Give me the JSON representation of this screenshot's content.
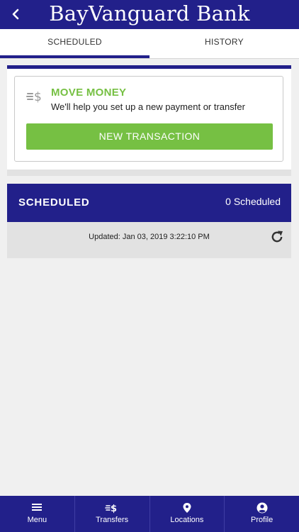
{
  "header": {
    "title": "BayVanguard Bank",
    "back_icon": "chevron-left-icon"
  },
  "tabs": [
    {
      "label": "SCHEDULED",
      "active": true
    },
    {
      "label": "HISTORY",
      "active": false
    }
  ],
  "move_money": {
    "icon": "transfer-dollar-icon",
    "title": "MOVE MONEY",
    "subtitle": "We'll help you set up a new payment or transfer",
    "button_label": "NEW TRANSACTION"
  },
  "scheduled": {
    "title": "SCHEDULED",
    "count_label": "0 Scheduled",
    "updated_prefix": "Updated: ",
    "updated_value": "Jan 03, 2019 3:22:10 PM",
    "refresh_icon": "refresh-icon"
  },
  "bottom_nav": [
    {
      "label": "Menu",
      "icon": "menu-icon"
    },
    {
      "label": "Transfers",
      "icon": "transfer-dollar-icon"
    },
    {
      "label": "Locations",
      "icon": "location-pin-icon"
    },
    {
      "label": "Profile",
      "icon": "profile-icon"
    }
  ],
  "colors": {
    "brand": "#22208a",
    "accent": "#76c043",
    "background": "#f0f0f0"
  }
}
